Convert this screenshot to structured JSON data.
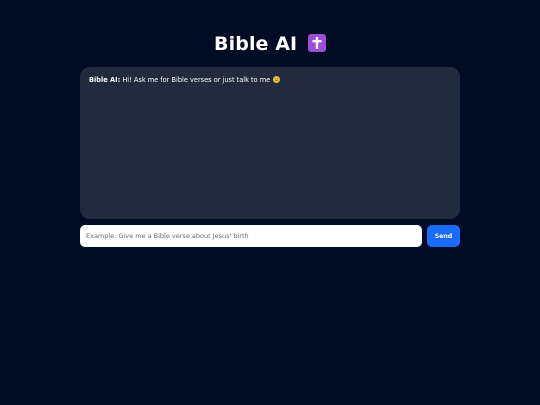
{
  "header": {
    "title": "Bible AI",
    "title_icon": "latin-cross-emoji"
  },
  "chat": {
    "messages": [
      {
        "speaker": "Bible AI:",
        "text": "Hi! Ask me for Bible verses or just talk to me",
        "emoji": "smiling-face-emoji"
      }
    ]
  },
  "composer": {
    "placeholder": "Example: Give me a Bible verse about Jesus' birth",
    "value": "",
    "send_label": "Send"
  },
  "colors": {
    "background": "#000b24",
    "chat_panel": "#222b3e",
    "accent": "#1a6bff",
    "cross_icon": "#9b4fd6"
  }
}
